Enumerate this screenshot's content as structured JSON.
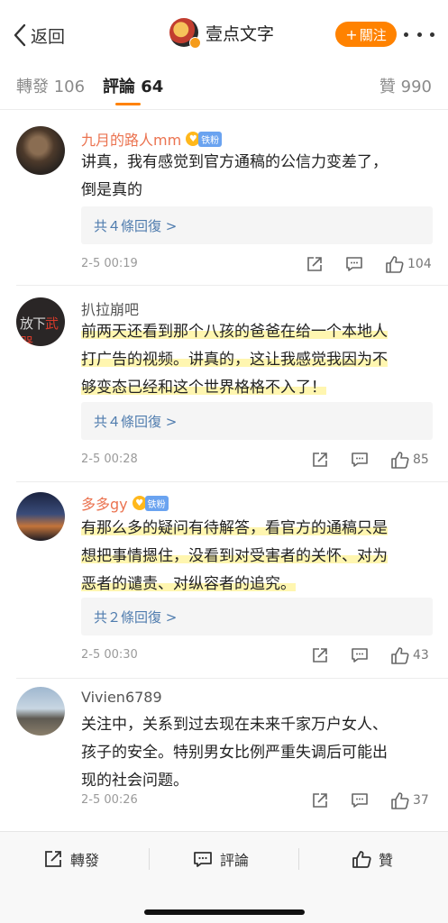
{
  "header": {
    "back_label": "返回",
    "author_name": "壹点文字",
    "follow_label": "關注",
    "accent": "#ff8200"
  },
  "tabs": {
    "repost": "轉發 106",
    "comment": "評論 64",
    "like": "贊 990"
  },
  "comments": [
    {
      "user": "九月的路人mm",
      "badge": "铁粉",
      "text_lines": [
        "讲真，我有感觉到官方通稿的公信力变差了，",
        "倒是真的"
      ],
      "replies": "共４條回復 >",
      "time": "2-5 00:19",
      "likes": "104"
    },
    {
      "user": "扒拉崩吧",
      "avatar_text": "放下",
      "avatar_text_red": "武器",
      "text_lines": [
        "前两天还看到那个八孩的爸爸在给一个本地人",
        "打广告的视频。讲真的，这让我感觉我因为不",
        "够变态已经和这个世界格格不入了！"
      ],
      "replies": "共４條回復 >",
      "time": "2-5 00:28",
      "likes": "85"
    },
    {
      "user": "多多gy",
      "badge": "铁粉",
      "text_lines": [
        "有那么多的疑问有待解答，看官方的通稿只是",
        "想把事情摁住，没看到对受害者的关怀、对为",
        "恶者的谴责、对纵容者的追究。"
      ],
      "replies": "共２條回復 >",
      "time": "2-5 00:30",
      "likes": "43"
    },
    {
      "user": "Vivien6789",
      "text_lines": [
        "关注中，关系到过去现在未来千家万户女人、",
        "孩子的安全。特别男女比例严重失调后可能出",
        "现的社会问题。"
      ],
      "time": "2-5 00:26",
      "likes": "37"
    }
  ],
  "bottom_bar": {
    "repost": "轉發",
    "comment": "評論",
    "like": "贊"
  },
  "icons": [
    "back-chevron-icon",
    "more-dots-icon",
    "share-icon",
    "comment-icon",
    "like-icon"
  ]
}
